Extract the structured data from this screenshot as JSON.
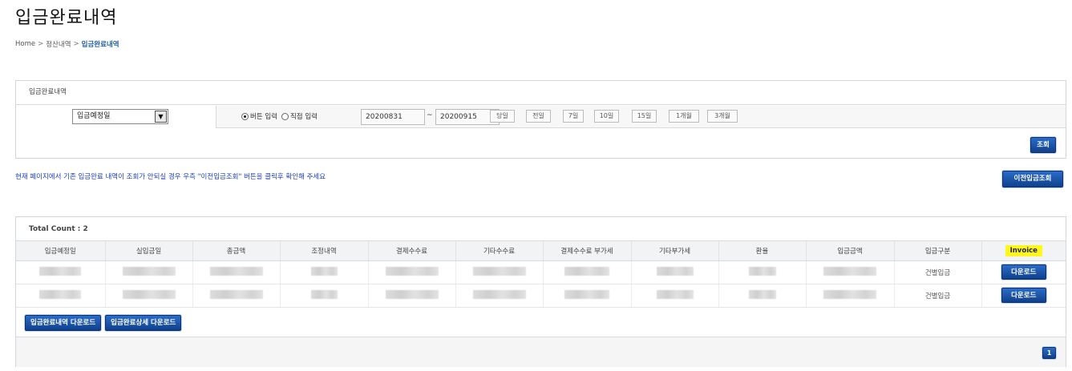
{
  "page_title": "입금완료내역",
  "breadcrumb": {
    "home": "Home",
    "separator": ">",
    "level1": "정산내역",
    "current": "입금완료내역"
  },
  "search": {
    "box_title": "입금완료내역",
    "date_type_selected": "입금예정일",
    "radio_button_input": "버튼 입력",
    "radio_direct_input": "직접 입력",
    "start_date": "20200831",
    "range_separator": "~",
    "end_date": "20200915",
    "quick_ranges": [
      "당일",
      "전일",
      "7일",
      "10일",
      "15일",
      "1개월",
      "3개월"
    ],
    "search_button": "조회"
  },
  "notice": "현재 페이지에서 기존 입금완료 내역이 조회가 안되실 경우 우측 \"이전입금조회\" 버튼을 클릭후 확인해 주세요",
  "prev_deposit_button": "이전입금조회",
  "results": {
    "total_count_label": "Total Count : 2",
    "columns": [
      "입금예정일",
      "실입금일",
      "총금액",
      "조정내역",
      "결제수수료",
      "기타수수료",
      "결제수수료 부가세",
      "기타부가세",
      "환율",
      "입금금액",
      "입금구분",
      "Invoice"
    ],
    "rows": [
      {
        "deposit_type": "건별입금",
        "invoice_button": "다운로드"
      },
      {
        "deposit_type": "건별입금",
        "invoice_button": "다운로드"
      }
    ],
    "download_list_button": "입금완료내역 다운로드",
    "download_detail_button": "입금완료상세 다운로드",
    "current_page": "1"
  },
  "colors": {
    "accent_blue": "#10408c",
    "invoice_highlight": "#fff81a",
    "notice_text": "#1e3fbf"
  }
}
